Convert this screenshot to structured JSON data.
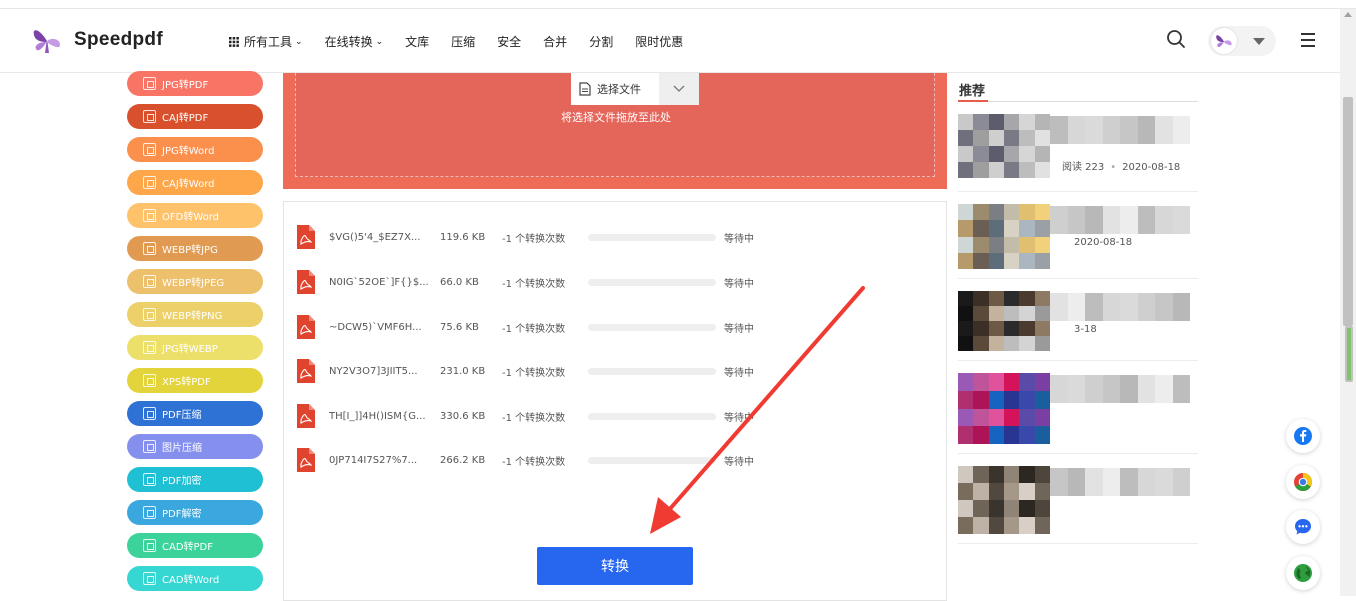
{
  "brand": {
    "name": "Speedpdf"
  },
  "nav": {
    "items": [
      {
        "label": "所有工具",
        "dropdown": true
      },
      {
        "label": "在线转换",
        "dropdown": true
      },
      {
        "label": "文库",
        "dropdown": false
      },
      {
        "label": "压缩",
        "dropdown": false
      },
      {
        "label": "安全",
        "dropdown": false
      },
      {
        "label": "合并",
        "dropdown": false
      },
      {
        "label": "分割",
        "dropdown": false
      },
      {
        "label": "限时优惠",
        "dropdown": false
      }
    ]
  },
  "sidebar": {
    "items": [
      {
        "label": "JPG转PDF",
        "color": "#f87565"
      },
      {
        "label": "CAJ转PDF",
        "color": "#d8502c"
      },
      {
        "label": "JPG转Word",
        "color": "#fb8f4c"
      },
      {
        "label": "CAJ转Word",
        "color": "#fda64a"
      },
      {
        "label": "OFD转Word",
        "color": "#fdc26a"
      },
      {
        "label": "WEBP转JPG",
        "color": "#e09a52"
      },
      {
        "label": "WEBP转JPEG",
        "color": "#edc06c"
      },
      {
        "label": "WEBP转PNG",
        "color": "#ecd06a"
      },
      {
        "label": "JPG转WEBP",
        "color": "#ece06a"
      },
      {
        "label": "XPS转PDF",
        "color": "#e4d43c"
      },
      {
        "label": "PDF压缩",
        "color": "#2f72d6"
      },
      {
        "label": "图片压缩",
        "color": "#8590ee"
      },
      {
        "label": "PDF加密",
        "color": "#1fc0d3"
      },
      {
        "label": "PDF解密",
        "color": "#3aa8de"
      },
      {
        "label": "CAD转PDF",
        "color": "#3bd39a"
      },
      {
        "label": "CAD转Word",
        "color": "#36d6d2"
      }
    ]
  },
  "upload": {
    "select_label": "选择文件",
    "drop_hint": "将选择文件拖放至此处"
  },
  "files": {
    "rows": [
      {
        "name": "$VG()5'4_$EZ7X...",
        "size": "119.6 KB",
        "cost": "-1 个转换次数",
        "progress": 0,
        "status": "等待中"
      },
      {
        "name": "N0IG`52OE`]F{}$...",
        "size": "66.0 KB",
        "cost": "-1 个转换次数",
        "progress": 0,
        "status": "等待中"
      },
      {
        "name": "~DCW5)`VMF6H...",
        "size": "75.6 KB",
        "cost": "-1 个转换次数",
        "progress": 0,
        "status": "等待中"
      },
      {
        "name": "NY2V3O7]3JIIT5...",
        "size": "231.0 KB",
        "cost": "-1 个转换次数",
        "progress": 0,
        "status": "等待中"
      },
      {
        "name": "TH[I_]]4H()ISM{G...",
        "size": "330.6 KB",
        "cost": "-1 个转换次数",
        "progress": 0,
        "status": "等待中"
      },
      {
        "name": "0JP714I7S27%7...",
        "size": "266.2 KB",
        "cost": "-1 个转换次数",
        "progress": 0,
        "status": "等待中"
      }
    ],
    "convert_label": "转换"
  },
  "recommend": {
    "title": "推荐",
    "items": [
      {
        "meta_views": "阅读 223",
        "meta_dot": "•",
        "meta_date": "2020-08-18"
      },
      {
        "meta_views": "",
        "meta_dot": "",
        "meta_date": "2020-08-18"
      },
      {
        "meta_views": "",
        "meta_dot": "",
        "meta_date": "3-18"
      },
      {
        "meta_views": "",
        "meta_dot": "",
        "meta_date": ""
      },
      {
        "meta_views": "",
        "meta_dot": "",
        "meta_date": ""
      }
    ]
  },
  "floating": {
    "buttons": [
      {
        "icon": "facebook-icon",
        "color": "#1877f2"
      },
      {
        "icon": "chrome-icon",
        "color": "#e34234"
      },
      {
        "icon": "chat-icon",
        "color": "#2766ef"
      },
      {
        "icon": "globe-icon",
        "color": "#2e9e3e"
      }
    ]
  },
  "annotation": {
    "arrow_color": "#ef3b32"
  }
}
